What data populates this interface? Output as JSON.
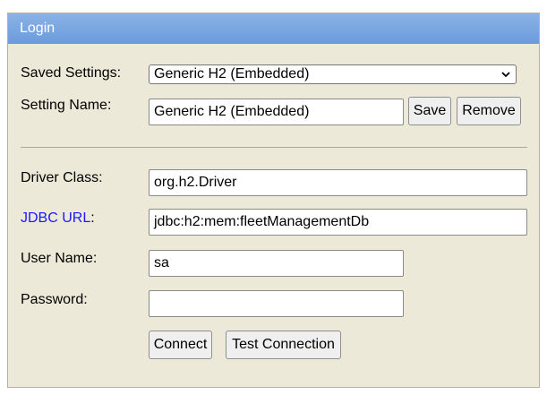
{
  "window": {
    "title": "Login"
  },
  "saved_settings": {
    "label": "Saved Settings:",
    "selected": "Generic H2 (Embedded)"
  },
  "setting_name": {
    "label": "Setting Name:",
    "value": "Generic H2 (Embedded)",
    "save_label": "Save",
    "remove_label": "Remove"
  },
  "driver_class": {
    "label": "Driver Class:",
    "value": "org.h2.Driver"
  },
  "jdbc_url": {
    "label": "JDBC URL",
    "suffix": ":",
    "value": "jdbc:h2:mem:fleetManagementDb"
  },
  "user_name": {
    "label": "User Name:",
    "value": "sa"
  },
  "password": {
    "label": "Password:",
    "value": ""
  },
  "actions": {
    "connect_label": "Connect",
    "test_label": "Test Connection"
  },
  "icons": {
    "dropdown": "chevron-down-icon"
  }
}
